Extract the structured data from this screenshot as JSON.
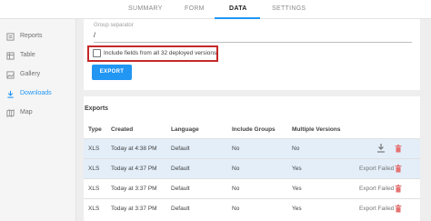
{
  "tabs": [
    {
      "label": "SUMMARY"
    },
    {
      "label": "FORM"
    },
    {
      "label": "DATA"
    },
    {
      "label": "SETTINGS"
    }
  ],
  "sidebar": {
    "items": [
      {
        "label": "Reports",
        "icon": "reports-icon"
      },
      {
        "label": "Table",
        "icon": "table-icon"
      },
      {
        "label": "Gallery",
        "icon": "gallery-icon"
      },
      {
        "label": "Downloads",
        "icon": "download-icon"
      },
      {
        "label": "Map",
        "icon": "map-icon"
      }
    ]
  },
  "settings": {
    "group_separator_label": "Group separator",
    "group_separator_value": "/",
    "include_fields_label": "Include fields from all 32 deployed versions",
    "export_button": "EXPORT"
  },
  "exports": {
    "title": "Exports",
    "columns": [
      "Type",
      "Created",
      "Language",
      "Include Groups",
      "Multiple Versions"
    ],
    "rows": [
      {
        "type": "XLS",
        "created": "Today at 4:38 PM",
        "language": "Default",
        "groups": "No",
        "versions": "No",
        "status": ""
      },
      {
        "type": "XLS",
        "created": "Today at 4:37 PM",
        "language": "Default",
        "groups": "No",
        "versions": "Yes",
        "status": "Export Failed"
      },
      {
        "type": "XLS",
        "created": "Today at 3:37 PM",
        "language": "Default",
        "groups": "No",
        "versions": "Yes",
        "status": "Export Failed"
      },
      {
        "type": "XLS",
        "created": "Today at 3:37 PM",
        "language": "Default",
        "groups": "No",
        "versions": "Yes",
        "status": "Export Failed"
      }
    ]
  },
  "colors": {
    "accent": "#2196f3",
    "highlight_border": "#c62828",
    "selected_row": "#e3eef9",
    "trash": "#e57373"
  }
}
